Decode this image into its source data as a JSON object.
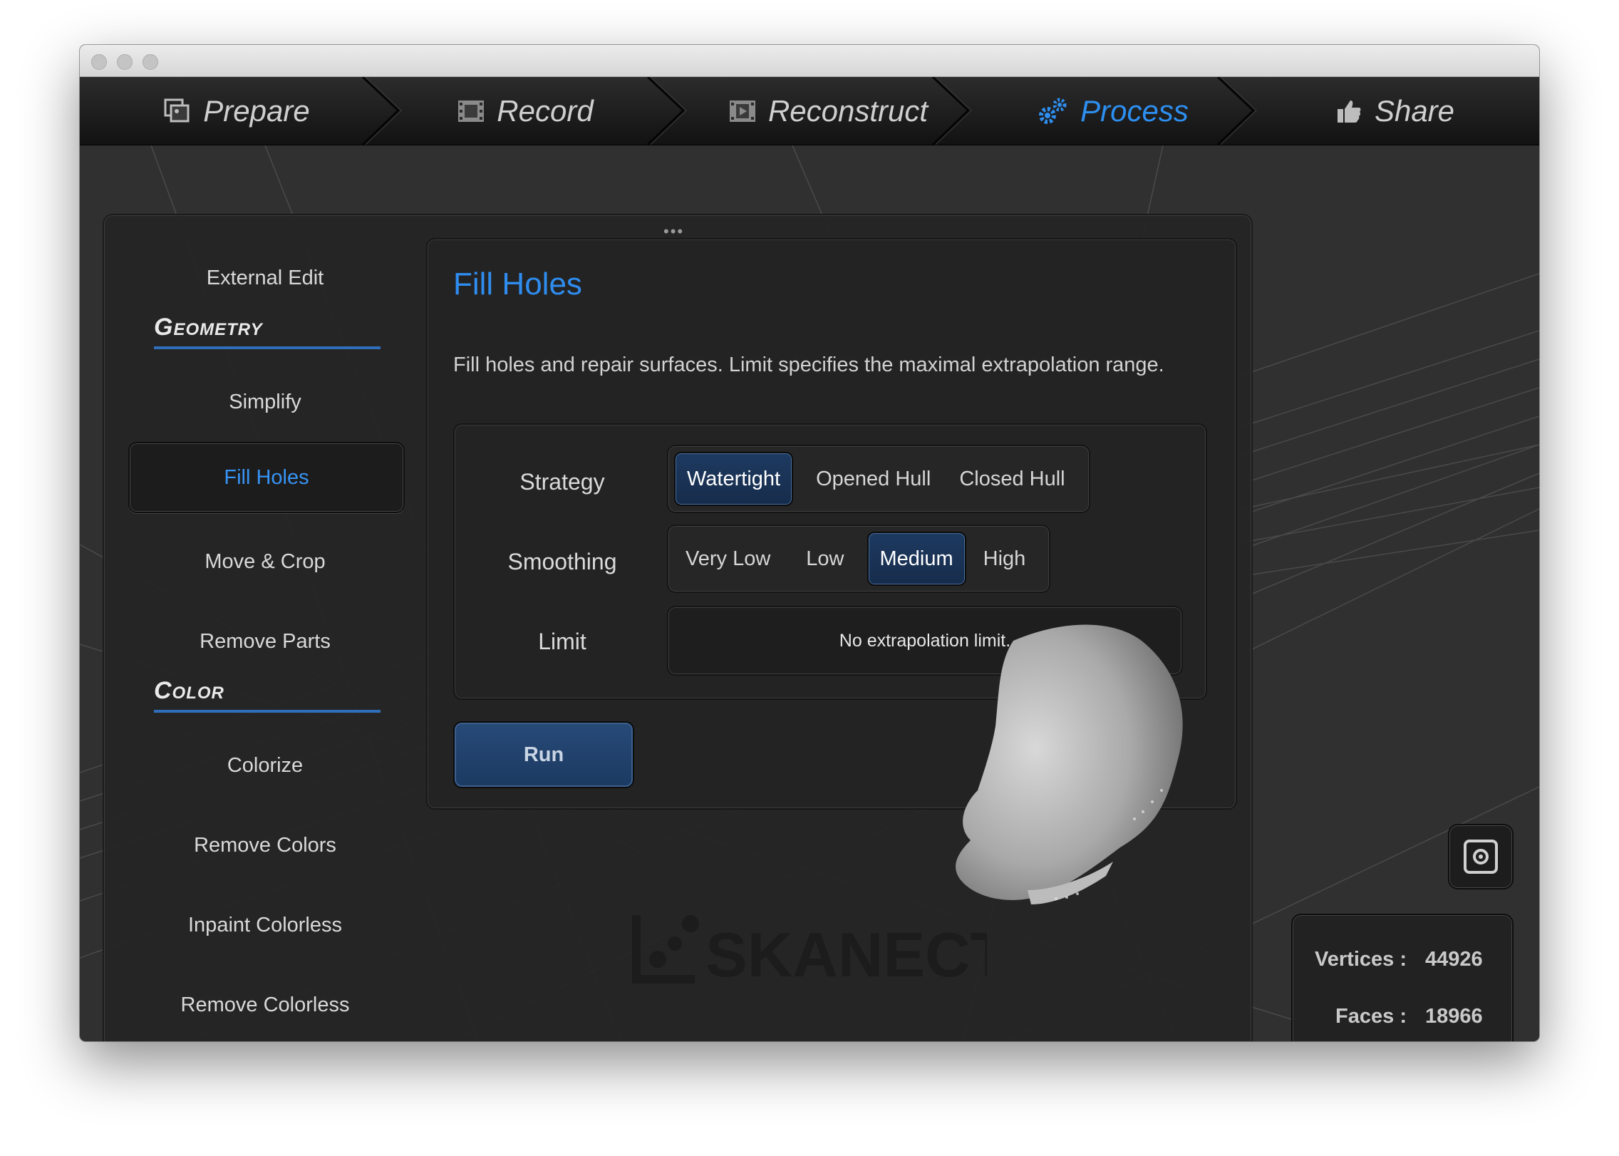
{
  "toolbar": {
    "steps": [
      {
        "label": "Prepare",
        "icon": "photos-icon"
      },
      {
        "label": "Record",
        "icon": "film-icon"
      },
      {
        "label": "Reconstruct",
        "icon": "film-frame-icon"
      },
      {
        "label": "Process",
        "icon": "gears-icon",
        "active": true
      },
      {
        "label": "Share",
        "icon": "thumbs-up-icon"
      }
    ]
  },
  "sidebar": {
    "external_edit": "External Edit",
    "geometry_header": "Geometry",
    "geometry_items": [
      "Simplify",
      "Fill Holes",
      "Move & Crop",
      "Remove Parts"
    ],
    "color_header": "Color",
    "color_items": [
      "Colorize",
      "Remove Colors",
      "Inpaint Colorless",
      "Remove Colorless"
    ],
    "selected": "Fill Holes"
  },
  "content": {
    "title": "Fill Holes",
    "description": "Fill holes and repair surfaces. Limit specifies the maximal extrapolation range.",
    "strategy": {
      "label": "Strategy",
      "options": [
        "Watertight",
        "Opened Hull",
        "Closed Hull"
      ],
      "selected": "Watertight"
    },
    "smoothing": {
      "label": "Smoothing",
      "options": [
        "Very Low",
        "Low",
        "Medium",
        "High"
      ],
      "selected": "Medium"
    },
    "limit": {
      "label": "Limit",
      "value": "No extrapolation limit."
    },
    "run_label": "Run"
  },
  "stats": {
    "vertices_label": "Vertices :",
    "vertices_value": "44926",
    "faces_label": "Faces :",
    "faces_value": "18966"
  },
  "logo_text": "SKANECT",
  "colors": {
    "accent": "#2d8ff0",
    "window_bg": "#303031",
    "panel_bg": "#252526",
    "selected_segment": "#1e3a61"
  }
}
